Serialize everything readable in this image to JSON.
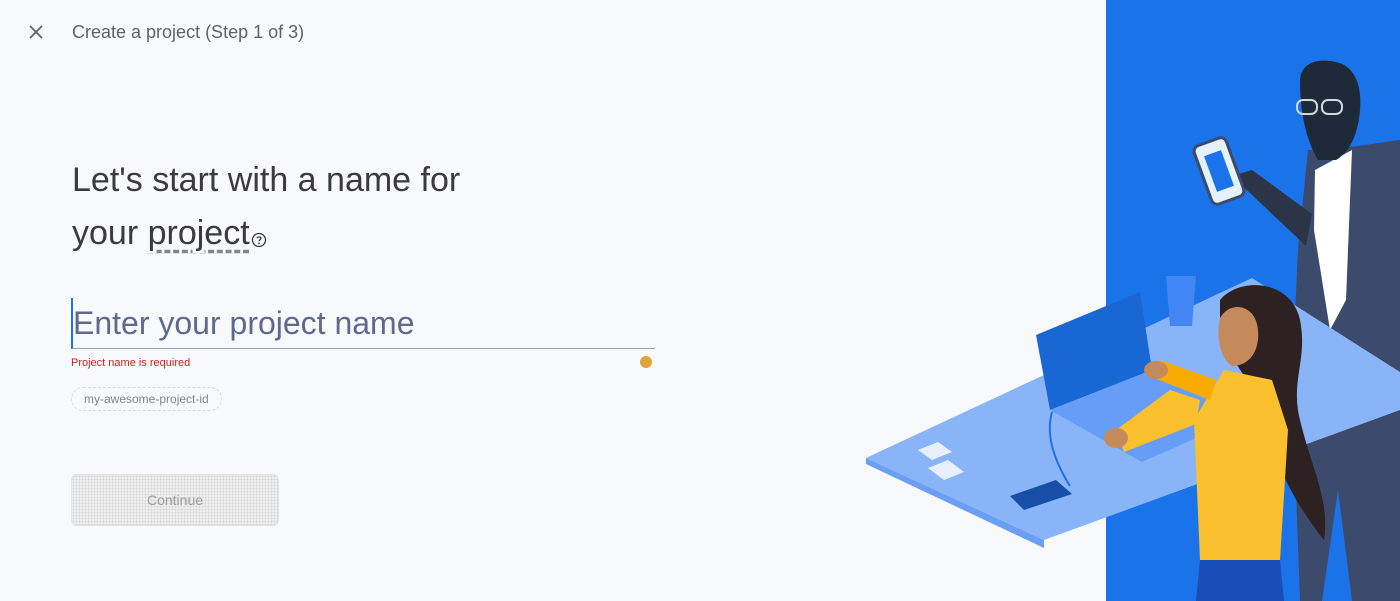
{
  "header": {
    "close_icon": "close-icon",
    "title": "Create a project (Step 1 of 3)"
  },
  "main": {
    "headline_line1": "Let's start with a name for",
    "headline_line2_prefix": "your",
    "headline_term": "project",
    "help_icon": "help-circle-icon",
    "name_input": {
      "value": "",
      "placeholder": "Enter your project name"
    },
    "error": {
      "text": "Project name is required",
      "icon": "error-icon"
    },
    "project_id_chip": "my-awesome-project-id",
    "continue_label": "Continue"
  },
  "colors": {
    "accent_blue": "#1a73e8",
    "error_red": "#c5221f",
    "background": "#f8f9fa",
    "illustration_blue": "#1a73e8",
    "shirt_yellow": "#fbc02d"
  }
}
